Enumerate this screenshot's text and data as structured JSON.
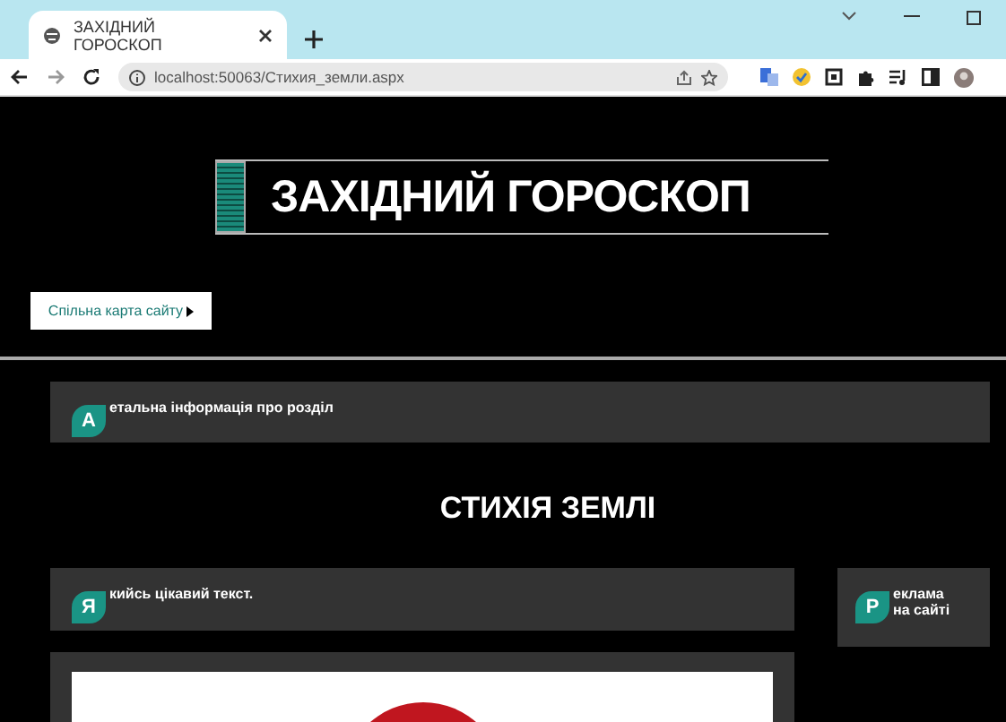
{
  "browser": {
    "tab_title": "ЗАХІДНИЙ ГОРОСКОП",
    "address": "localhost:50063/Стихия_земли.aspx"
  },
  "header": {
    "title": "ЗАХІДНИЙ ГОРОСКОП"
  },
  "sitemap_button": {
    "label": "Спільна карта сайту"
  },
  "panels": [
    {
      "cap": "А",
      "text": "етальна інформація про розділ"
    }
  ],
  "section_title": "СТИХІЯ ЗЕМЛІ",
  "content_panel": {
    "cap": "Я",
    "text": "кийсь цікавий текст."
  },
  "ad_panel": {
    "cap": "Р",
    "lines": [
      "еклама",
      "на сайті"
    ]
  }
}
